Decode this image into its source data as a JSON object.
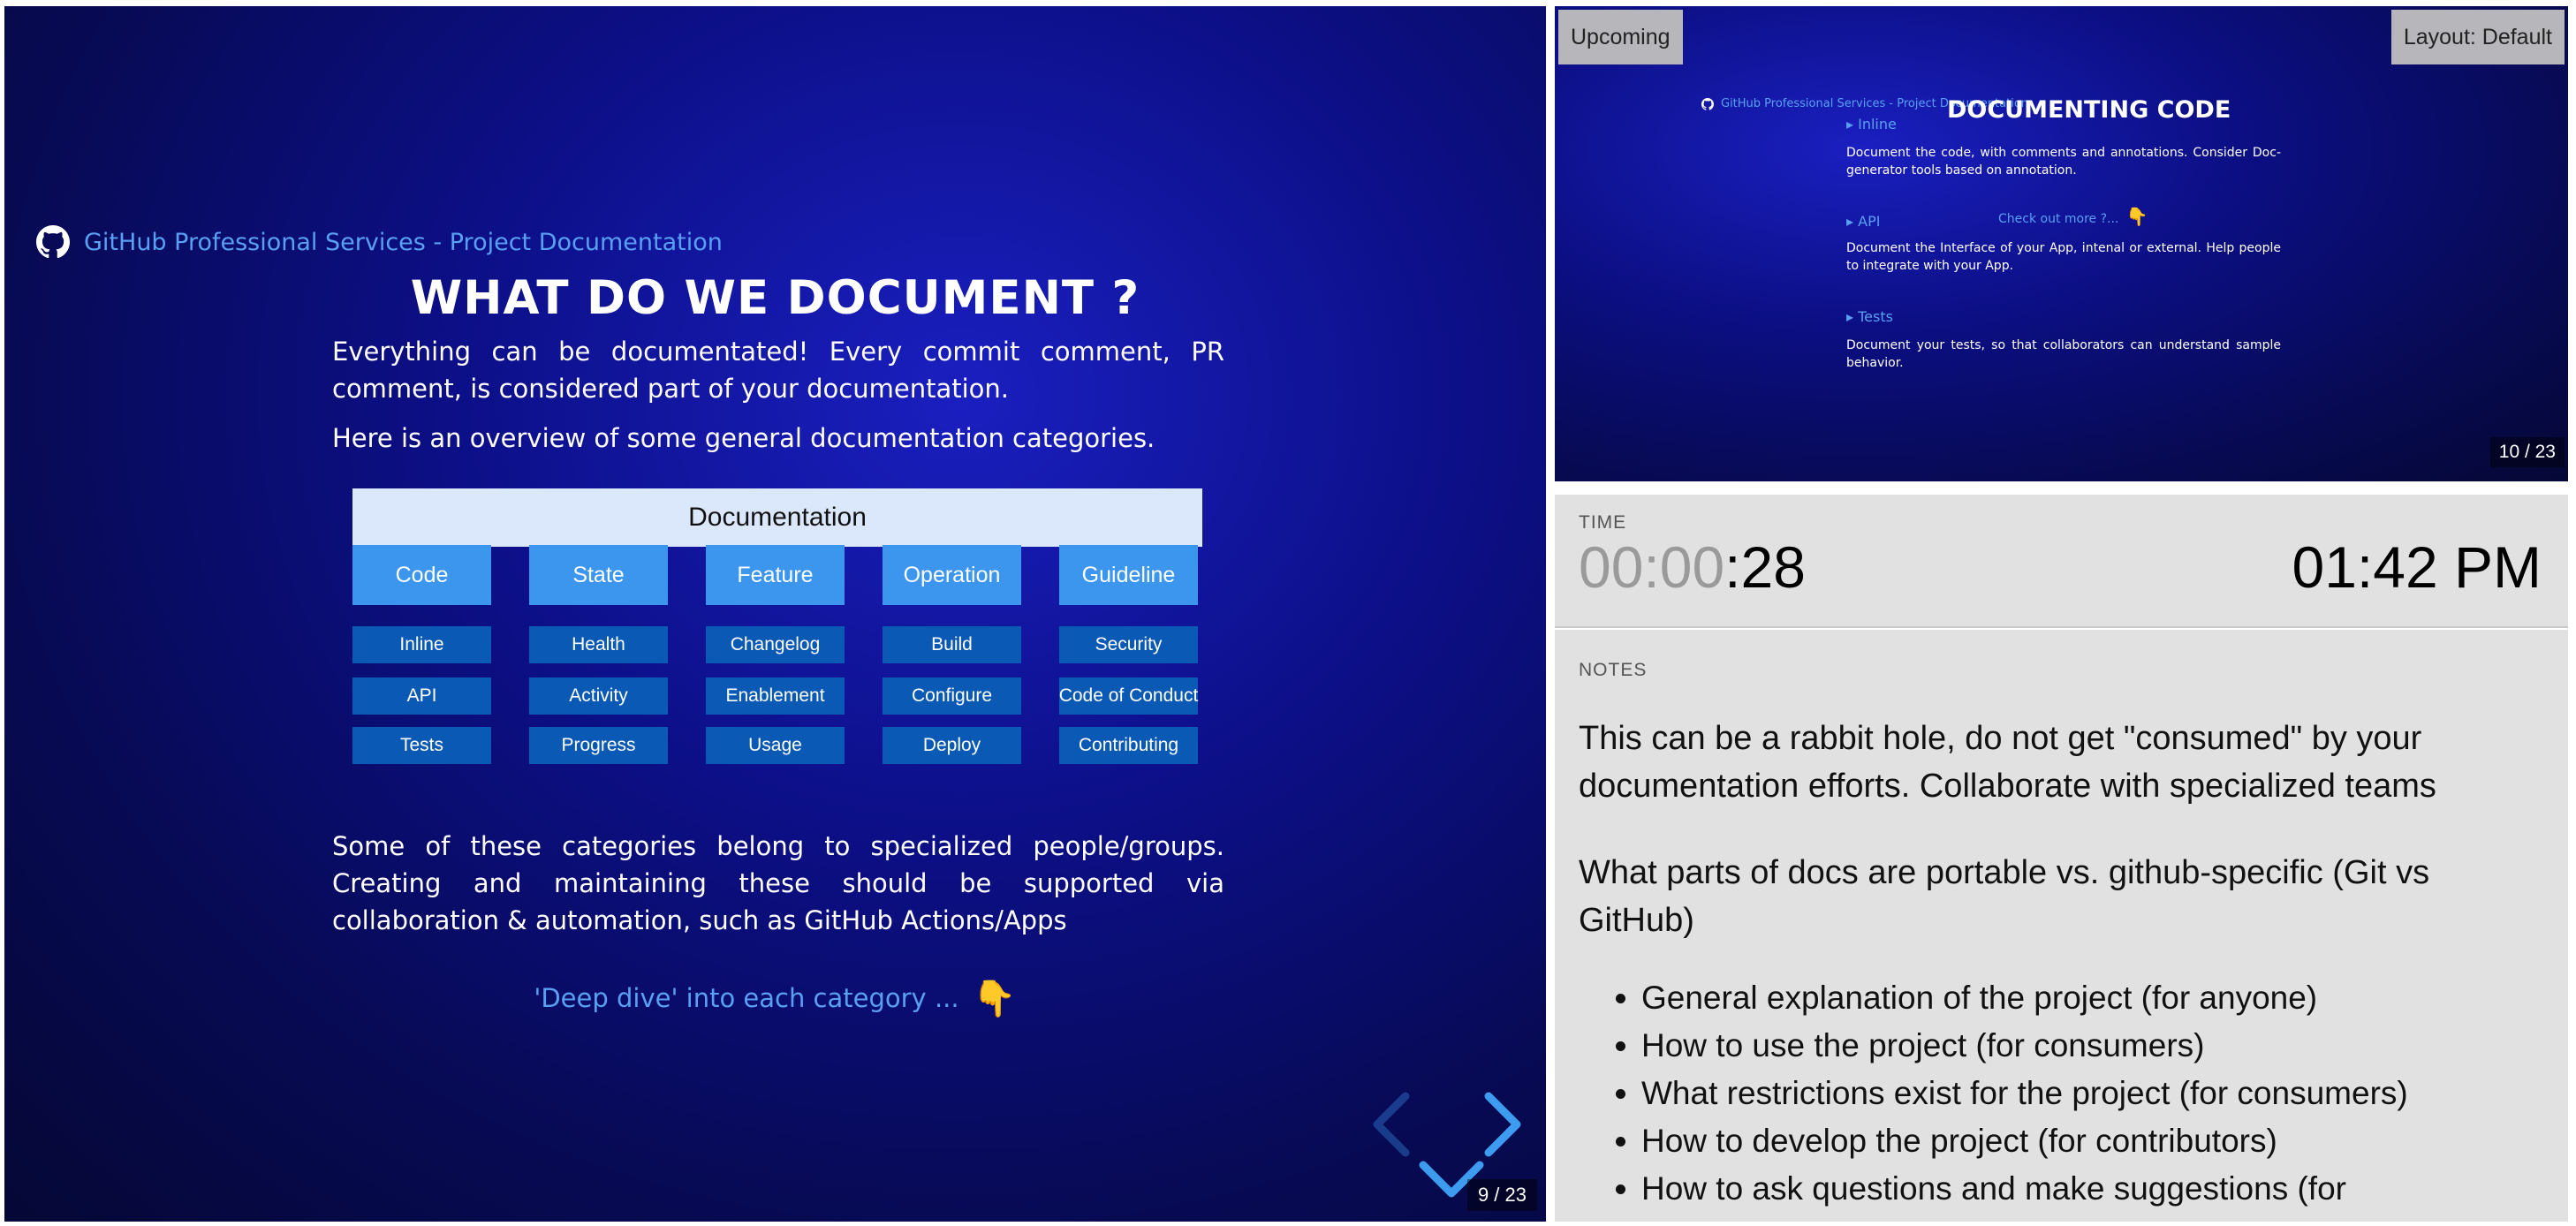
{
  "current_slide": {
    "brand": "GitHub Professional Services - Project Documentation",
    "title": "WHAT DO WE DOCUMENT ?",
    "para1": "Everything can be documentated! Every commit comment, PR comment, is considered part of your documentation.",
    "para2": "Here is an overview of some general documentation categories.",
    "diagram": {
      "root": "Documentation",
      "categories": [
        {
          "label": "Code",
          "items": [
            "Inline",
            "API",
            "Tests"
          ]
        },
        {
          "label": "State",
          "items": [
            "Health",
            "Activity",
            "Progress"
          ]
        },
        {
          "label": "Feature",
          "items": [
            "Changelog",
            "Enablement",
            "Usage"
          ]
        },
        {
          "label": "Operation",
          "items": [
            "Build",
            "Configure",
            "Deploy"
          ]
        },
        {
          "label": "Guideline",
          "items": [
            "Security",
            "Code of Conduct",
            "Contributing"
          ]
        }
      ]
    },
    "para3": "Some of these categories belong to specialized people/groups. Creating and maintaining these should be supported via collaboration & automation, such as GitHub Actions/Apps",
    "deep_dive": "'Deep dive' into each category ...",
    "deep_dive_emoji": "👇",
    "counter": "9  /  23"
  },
  "upcoming": {
    "tag": "Upcoming",
    "layout_tag": "Layout: Default",
    "brand": "GitHub Professional Services - Project Documentation",
    "title": "DOCUMENTING CODE",
    "items": [
      {
        "head": "▸ Inline",
        "text": "Document the code, with comments and annotations. Consider Doc-generator tools based on annotation."
      },
      {
        "head": "▸ API",
        "text": "Document the Interface of your App, intenal or external. Help people to integrate with your App."
      },
      {
        "head": "▸ Tests",
        "text": "Document your tests, so that collaborators can understand sample behavior."
      }
    ],
    "checkout": "Check out more ?...",
    "checkout_emoji": "👇",
    "counter": "10  /  23"
  },
  "time": {
    "label": "TIME",
    "timer_dim": "00:00",
    "timer_secs": ":28",
    "clock": "01:42 PM"
  },
  "notes": {
    "label": "NOTES",
    "p1": "This can be a rabbit hole, do not get \"consumed\" by your documentation efforts. Collaborate with specialized teams",
    "p2": "What parts of docs are portable vs. github-specific (Git vs GitHub)",
    "list": [
      "General explanation of the project (for anyone)",
      "How to use the project (for consumers)",
      "What restrictions exist for the project (for consumers)",
      "How to develop the project (for contributors)",
      "How to ask questions and make suggestions (for"
    ]
  },
  "colors": {
    "accent_link": "#5aa0f2",
    "category_blue": "#3d96ee",
    "item_blue": "#0a59b4",
    "nav_arrow": "#3d9cf0"
  }
}
